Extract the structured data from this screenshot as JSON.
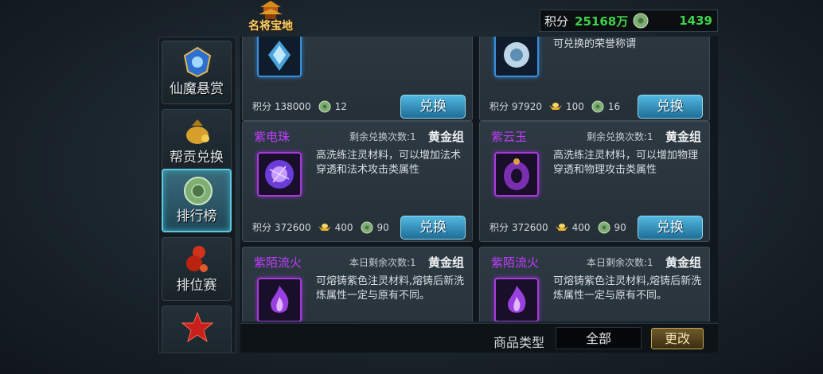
{
  "header": {
    "title": "名将宝地",
    "points_label": "积分",
    "points_value": "25168万",
    "jade_value": "1439"
  },
  "sidebar": {
    "items": [
      {
        "label": "仙魔悬赏",
        "icon": "blue-crest-icon"
      },
      {
        "label": "帮贡兑换",
        "icon": "gold-money-bag-icon"
      },
      {
        "label": "排行榜",
        "icon": "jade-coin-icon",
        "active": true
      },
      {
        "label": "排位赛",
        "icon": "red-gourd-icon"
      },
      {
        "label": "",
        "icon": "red-star-icon"
      }
    ]
  },
  "cards": [
    {
      "name": "",
      "remain": "",
      "group": "",
      "desc": "",
      "points": "积分 138000",
      "jade": "12",
      "gold": "",
      "button": "兑换"
    },
    {
      "name": "",
      "remain": "",
      "group": "",
      "desc": "可兑换的荣誉称谓",
      "points": "积分 97920",
      "gold": "100",
      "jade": "16",
      "button": "兑换"
    },
    {
      "name": "紫电珠",
      "remain": "剩余兑换次数:1",
      "group": "黄金组",
      "desc": "高洗练注灵材料，可以增加法术穿透和法术攻击类属性",
      "points": "积分 372600",
      "gold": "400",
      "jade": "90",
      "button": "兑换"
    },
    {
      "name": "紫云玉",
      "remain": "剩余兑换次数:1",
      "group": "黄金组",
      "desc": "高洗练注灵材料，可以增加物理穿透和物理攻击类属性",
      "points": "积分 372600",
      "gold": "400",
      "jade": "90",
      "button": "兑换"
    },
    {
      "name": "紫陌流火",
      "remain": "本日剩余次数:1",
      "group": "黄金组",
      "desc": "可熔铸紫色注灵材料,熔铸后新洗炼属性一定与原有不同。",
      "points": "",
      "gold": "",
      "jade": "",
      "button": ""
    },
    {
      "name": "紫陌流火",
      "remain": "本日剩余次数:1",
      "group": "黄金组",
      "desc": "可熔铸紫色注灵材料,熔铸后新洗炼属性一定与原有不同。",
      "points": "",
      "gold": "",
      "jade": "",
      "button": ""
    }
  ],
  "filter": {
    "label": "商品类型",
    "value": "全部",
    "button": "更改"
  },
  "colors": {
    "item_name_purple": "#c03cff",
    "value_green": "#3fd24a",
    "exchange_button": "#2f92c0",
    "title_gold": "#f3d36b"
  }
}
